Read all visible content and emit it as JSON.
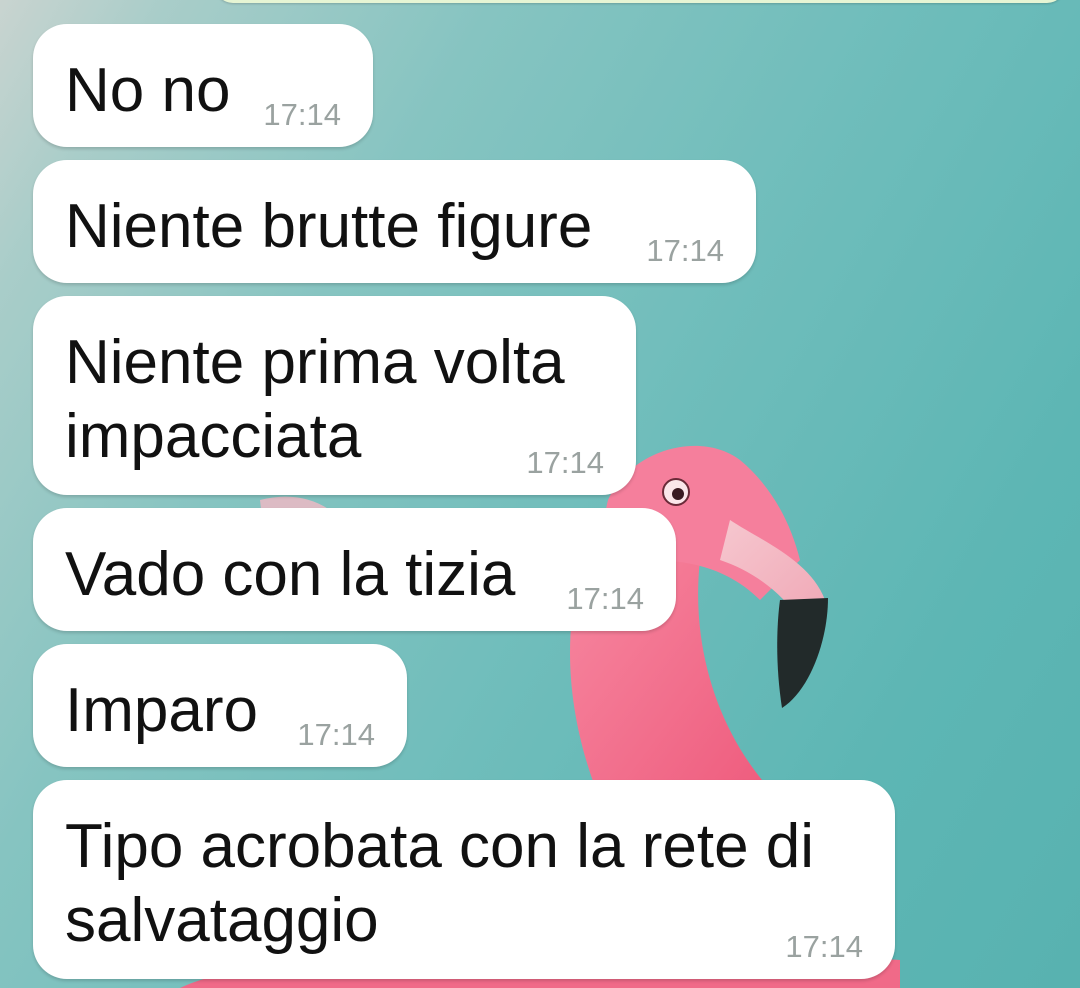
{
  "chat": {
    "background_icon": "flamingo-wallpaper",
    "accent_bubble_color": "#ffffff",
    "sent_bubble_color": "#e6f5d4",
    "messages": [
      {
        "text_lines": [
          "No no"
        ],
        "time": "17:14"
      },
      {
        "text_lines": [
          "Niente brutte figure"
        ],
        "time": "17:14"
      },
      {
        "text_lines": [
          "Niente prima volta",
          "impacciata"
        ],
        "time": "17:14"
      },
      {
        "text_lines": [
          "Vado con la tizia"
        ],
        "time": "17:14"
      },
      {
        "text_lines": [
          "Imparo"
        ],
        "time": "17:14"
      },
      {
        "text_lines": [
          "Tipo acrobata con la rete di",
          "salvataggio"
        ],
        "time": "17:14"
      }
    ]
  }
}
